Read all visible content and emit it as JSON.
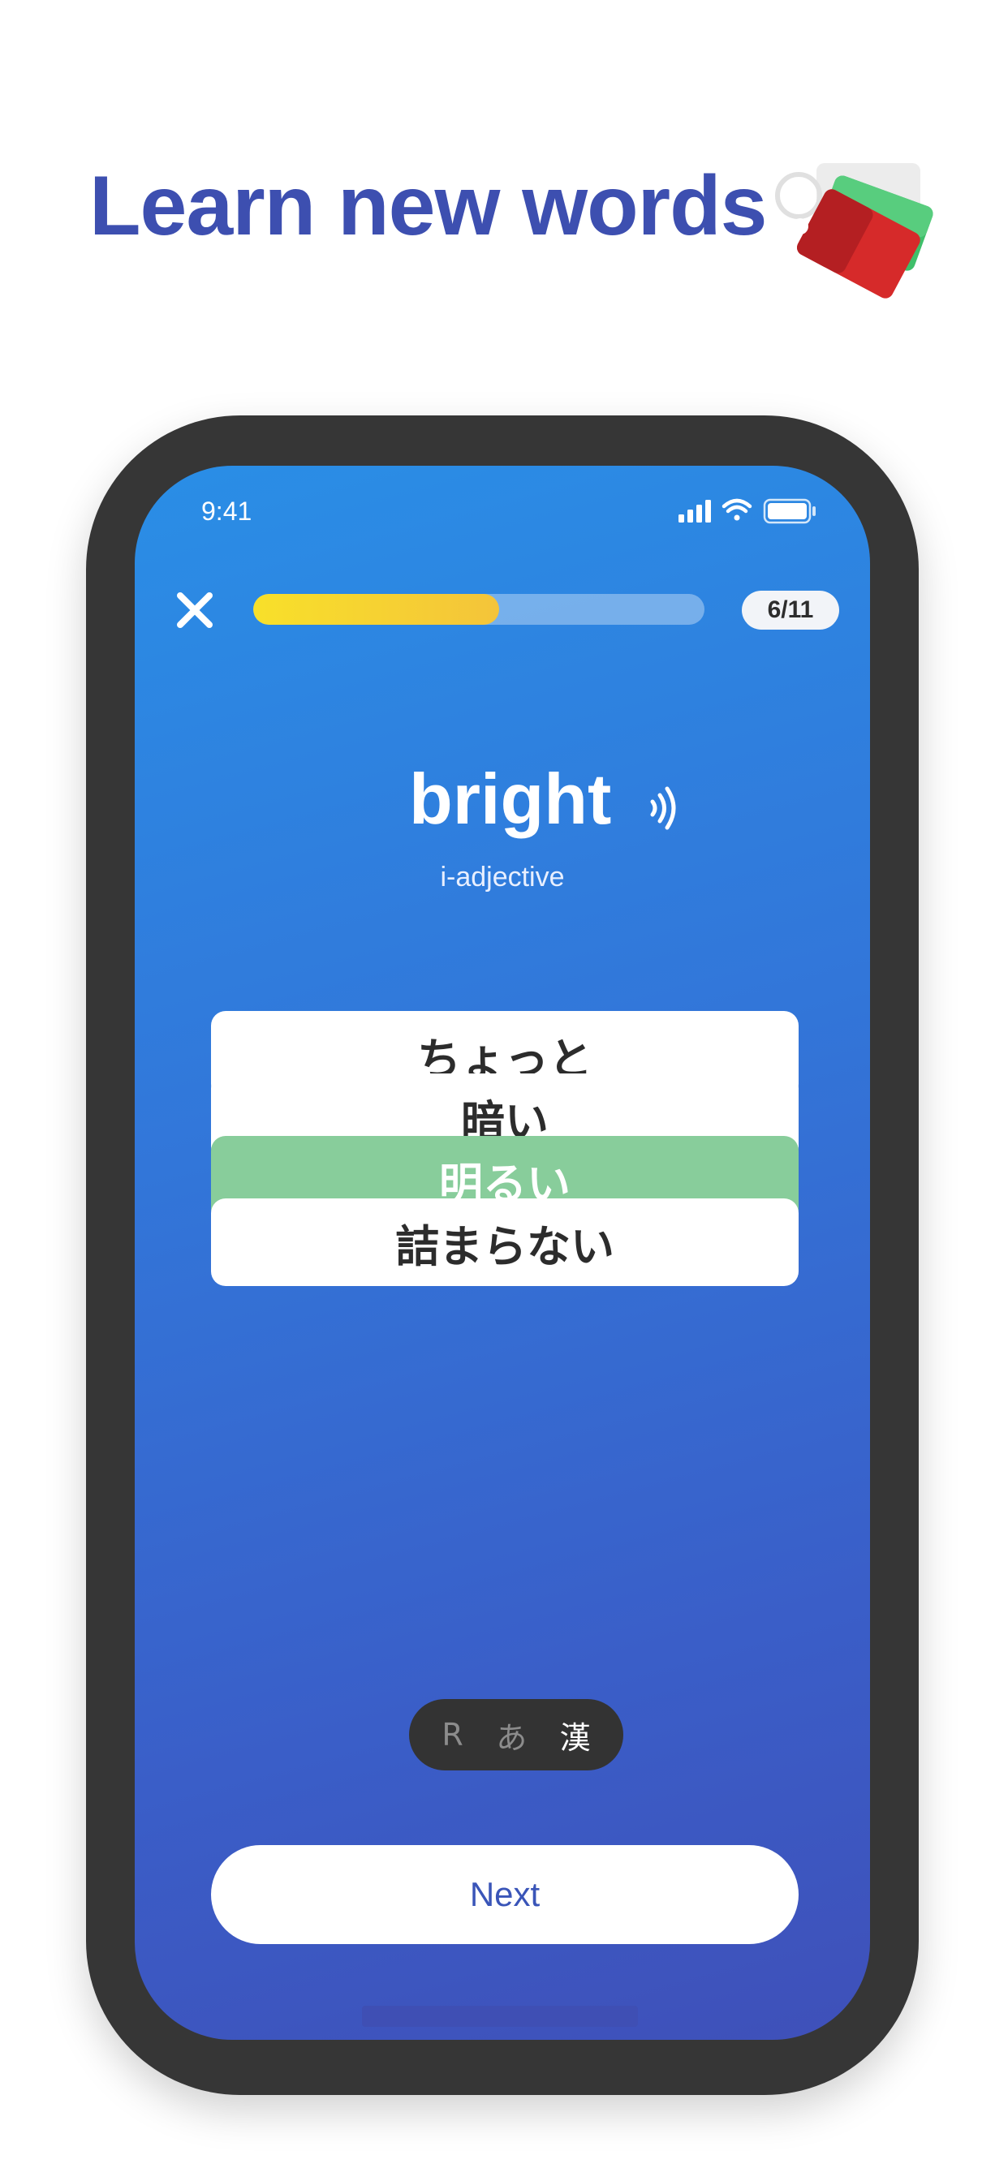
{
  "headline": "Learn new words",
  "status_bar": {
    "time": "9:41"
  },
  "quiz": {
    "progress_fraction": 0.545,
    "counter": "6/11",
    "word": "bright",
    "part_of_speech": "i-adjective",
    "options": [
      {
        "label": "ちょっと",
        "state": "default"
      },
      {
        "label": "暗い",
        "state": "default"
      },
      {
        "label": "明るい",
        "state": "correct"
      },
      {
        "label": "詰まらない",
        "state": "default"
      }
    ],
    "script_toggle": {
      "romaji": "R",
      "kana": "あ",
      "kanji": "漢",
      "selected": "kanji"
    },
    "next_label": "Next"
  },
  "colors": {
    "accent": "#3d4fb0",
    "correct": "#88cd9b",
    "progress_fill": "#f4c43a",
    "screen_top": "#2a8ee6",
    "screen_bottom": "#3f50b9"
  },
  "icons": [
    "cards-icon",
    "cellular-signal-icon",
    "wifi-icon",
    "battery-icon",
    "close-icon",
    "speaker-icon"
  ]
}
